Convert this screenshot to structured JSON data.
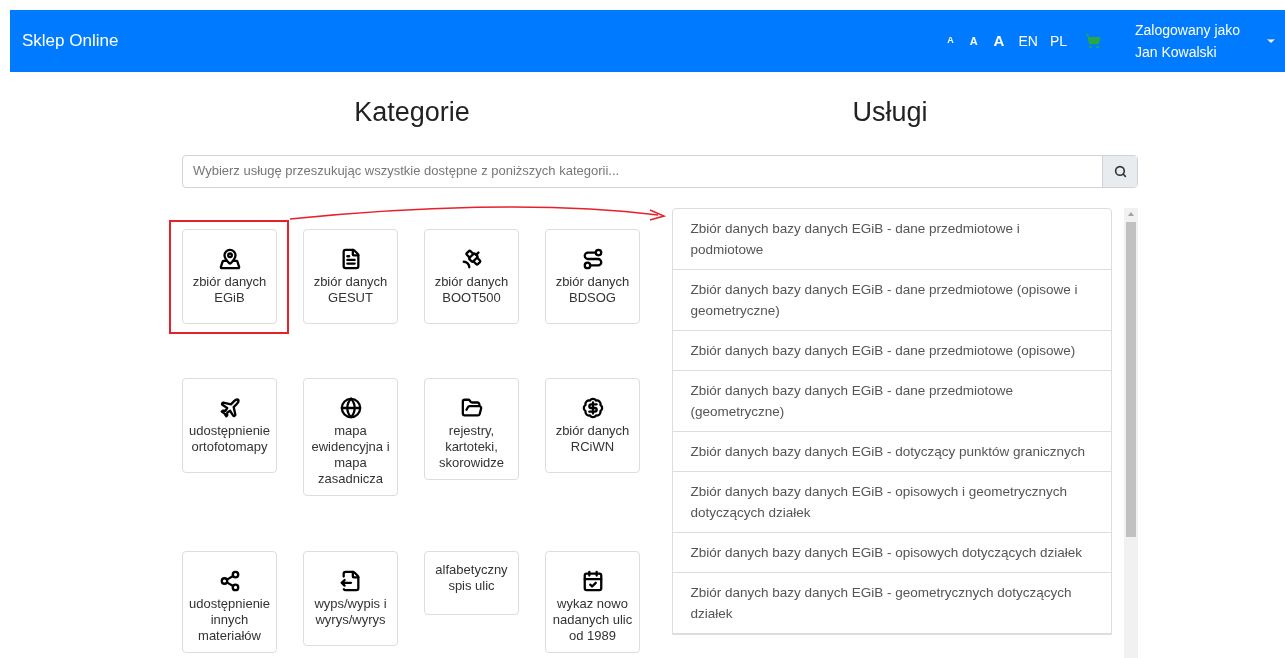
{
  "navbar": {
    "brand": "Sklep Online",
    "font_sizes": [
      {
        "label": "A",
        "kind": "small"
      },
      {
        "label": "A",
        "kind": "medium"
      },
      {
        "label": "A",
        "kind": "large"
      }
    ],
    "languages": [
      {
        "label": "EN"
      },
      {
        "label": "PL"
      }
    ],
    "user": {
      "line1": "Zalogowany jako",
      "line2": "Jan Kowalski"
    }
  },
  "categories_title": "Kategorie",
  "services_title": "Usługi",
  "search": {
    "placeholder": "Wybierz usługę przeszukując wszystkie dostępne z poniższych kategorii..."
  },
  "categories": [
    {
      "label": "zbiór danych EGiB",
      "kind": "map-house",
      "highlighted": true
    },
    {
      "label": "zbiór danych GESUT",
      "kind": "folder-pipe",
      "highlighted": false
    },
    {
      "label": "zbiór danych BOOT500",
      "kind": "map-target",
      "highlighted": false
    },
    {
      "label": "zbiór danych BDSOG",
      "kind": "road",
      "highlighted": false
    },
    {
      "label": "udostępnienie ortofotomapy",
      "kind": "plane",
      "highlighted": false
    },
    {
      "label": "mapa ewidencyjna i mapa zasadnicza",
      "kind": "globe",
      "highlighted": false
    },
    {
      "label": "rejestry, kartoteki, skorowidze",
      "kind": "folder-house",
      "highlighted": false
    },
    {
      "label": "zbiór danych RCiWN",
      "kind": "house-dollar",
      "highlighted": false
    },
    {
      "label": "udostępnienie innych materiałów",
      "kind": "map-share",
      "highlighted": false
    },
    {
      "label": "wyps/wypis i wyrys/wyrys",
      "kind": "map-export",
      "highlighted": false
    },
    {
      "label": "alfabetyczny spis ulic",
      "kind": "text",
      "highlighted": false
    },
    {
      "label": "wykaz nowo nadanych ulic od 1989",
      "kind": "calendar-check",
      "highlighted": false
    }
  ],
  "services": [
    "Zbiór danych bazy danych EGiB - dane przedmiotowe i podmiotowe",
    "Zbiór danych bazy danych EGiB - dane przedmiotowe (opisowe i geometryczne)",
    "Zbiór danych bazy danych EGiB - dane przedmiotowe (opisowe)",
    "Zbiór danych bazy danych EGiB - dane przedmiotowe (geometryczne)",
    "Zbiór danych bazy danych EGiB - dotyczący punktów granicznych",
    "Zbiór danych bazy danych EGiB - opisowych i geometrycznych dotyczących działek",
    "Zbiór danych bazy danych EGiB - opisowych dotyczących działek",
    "Zbiór danych bazy danych EGiB - geometrycznych dotyczących działek"
  ]
}
